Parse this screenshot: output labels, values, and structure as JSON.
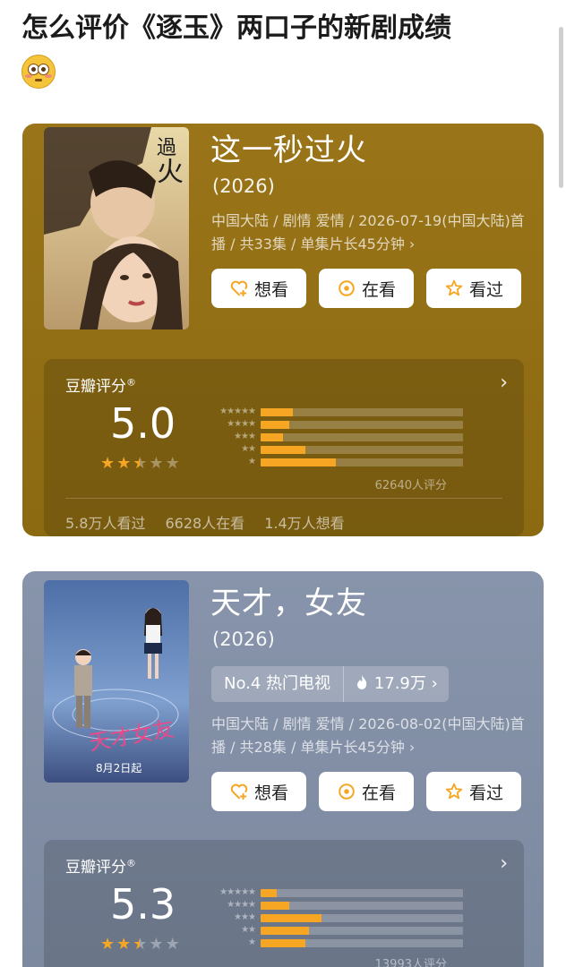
{
  "post": {
    "title": "怎么评价《逐玉》两口子的新剧成绩"
  },
  "colors": {
    "card1_bg": "#8b6a12",
    "card2_bg": "#7c899f",
    "accent_orange": "#f6a623"
  },
  "cards": [
    {
      "title": "这一秒过火",
      "year": "(2026)",
      "info": "中国大陆 / 剧情 爱情 / 2026-07-19(中国大陆)首播 / 共33集 / 单集片长45分钟 ›",
      "buttons": {
        "want": "想看",
        "watching": "在看",
        "watched": "看过"
      },
      "rating": {
        "label": "豆瓣评分",
        "mark": "®",
        "score": "5.0",
        "stars_filled": 2.5,
        "distribution": [
          0.16,
          0.14,
          0.11,
          0.22,
          0.37
        ],
        "count_text": "62640人评分",
        "stats": [
          "5.8万人看过",
          "6628人在看",
          "1.4万人想看"
        ]
      }
    },
    {
      "title": "天才，女友",
      "year": "(2026)",
      "hot": {
        "rank": "No.4 热门电视",
        "heat": "17.9万"
      },
      "info": "中国大陆 / 剧情 爱情 / 2026-08-02(中国大陆)首播 / 共28集 / 单集片长45分钟 ›",
      "buttons": {
        "want": "想看",
        "watching": "在看",
        "watched": "看过"
      },
      "rating": {
        "label": "豆瓣评分",
        "mark": "®",
        "score": "5.3",
        "stars_filled": 2.5,
        "distribution": [
          0.08,
          0.14,
          0.3,
          0.24,
          0.22
        ],
        "count_text": "13993人评分"
      }
    }
  ]
}
